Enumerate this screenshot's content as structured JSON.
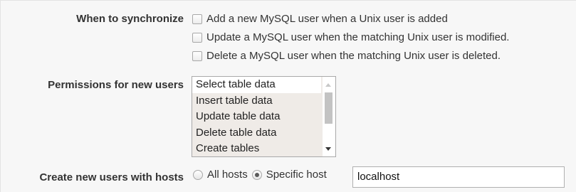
{
  "sync": {
    "label": "When to synchronize",
    "options": [
      {
        "label": "Add a new MySQL user when a Unix user is added",
        "checked": false
      },
      {
        "label": "Update a MySQL user when the matching Unix user is modified.",
        "checked": false
      },
      {
        "label": "Delete a MySQL user when the matching Unix user is deleted.",
        "checked": false
      }
    ]
  },
  "permissions": {
    "label": "Permissions for new users",
    "options": [
      "Select table data",
      "Insert table data",
      "Update table data",
      "Delete table data",
      "Create tables"
    ]
  },
  "hosts": {
    "label": "Create new users with hosts",
    "all_hosts_label": "All hosts",
    "all_hosts_selected": false,
    "specific_host_label": "Specific host",
    "specific_host_selected": true,
    "host_value": "localhost"
  }
}
